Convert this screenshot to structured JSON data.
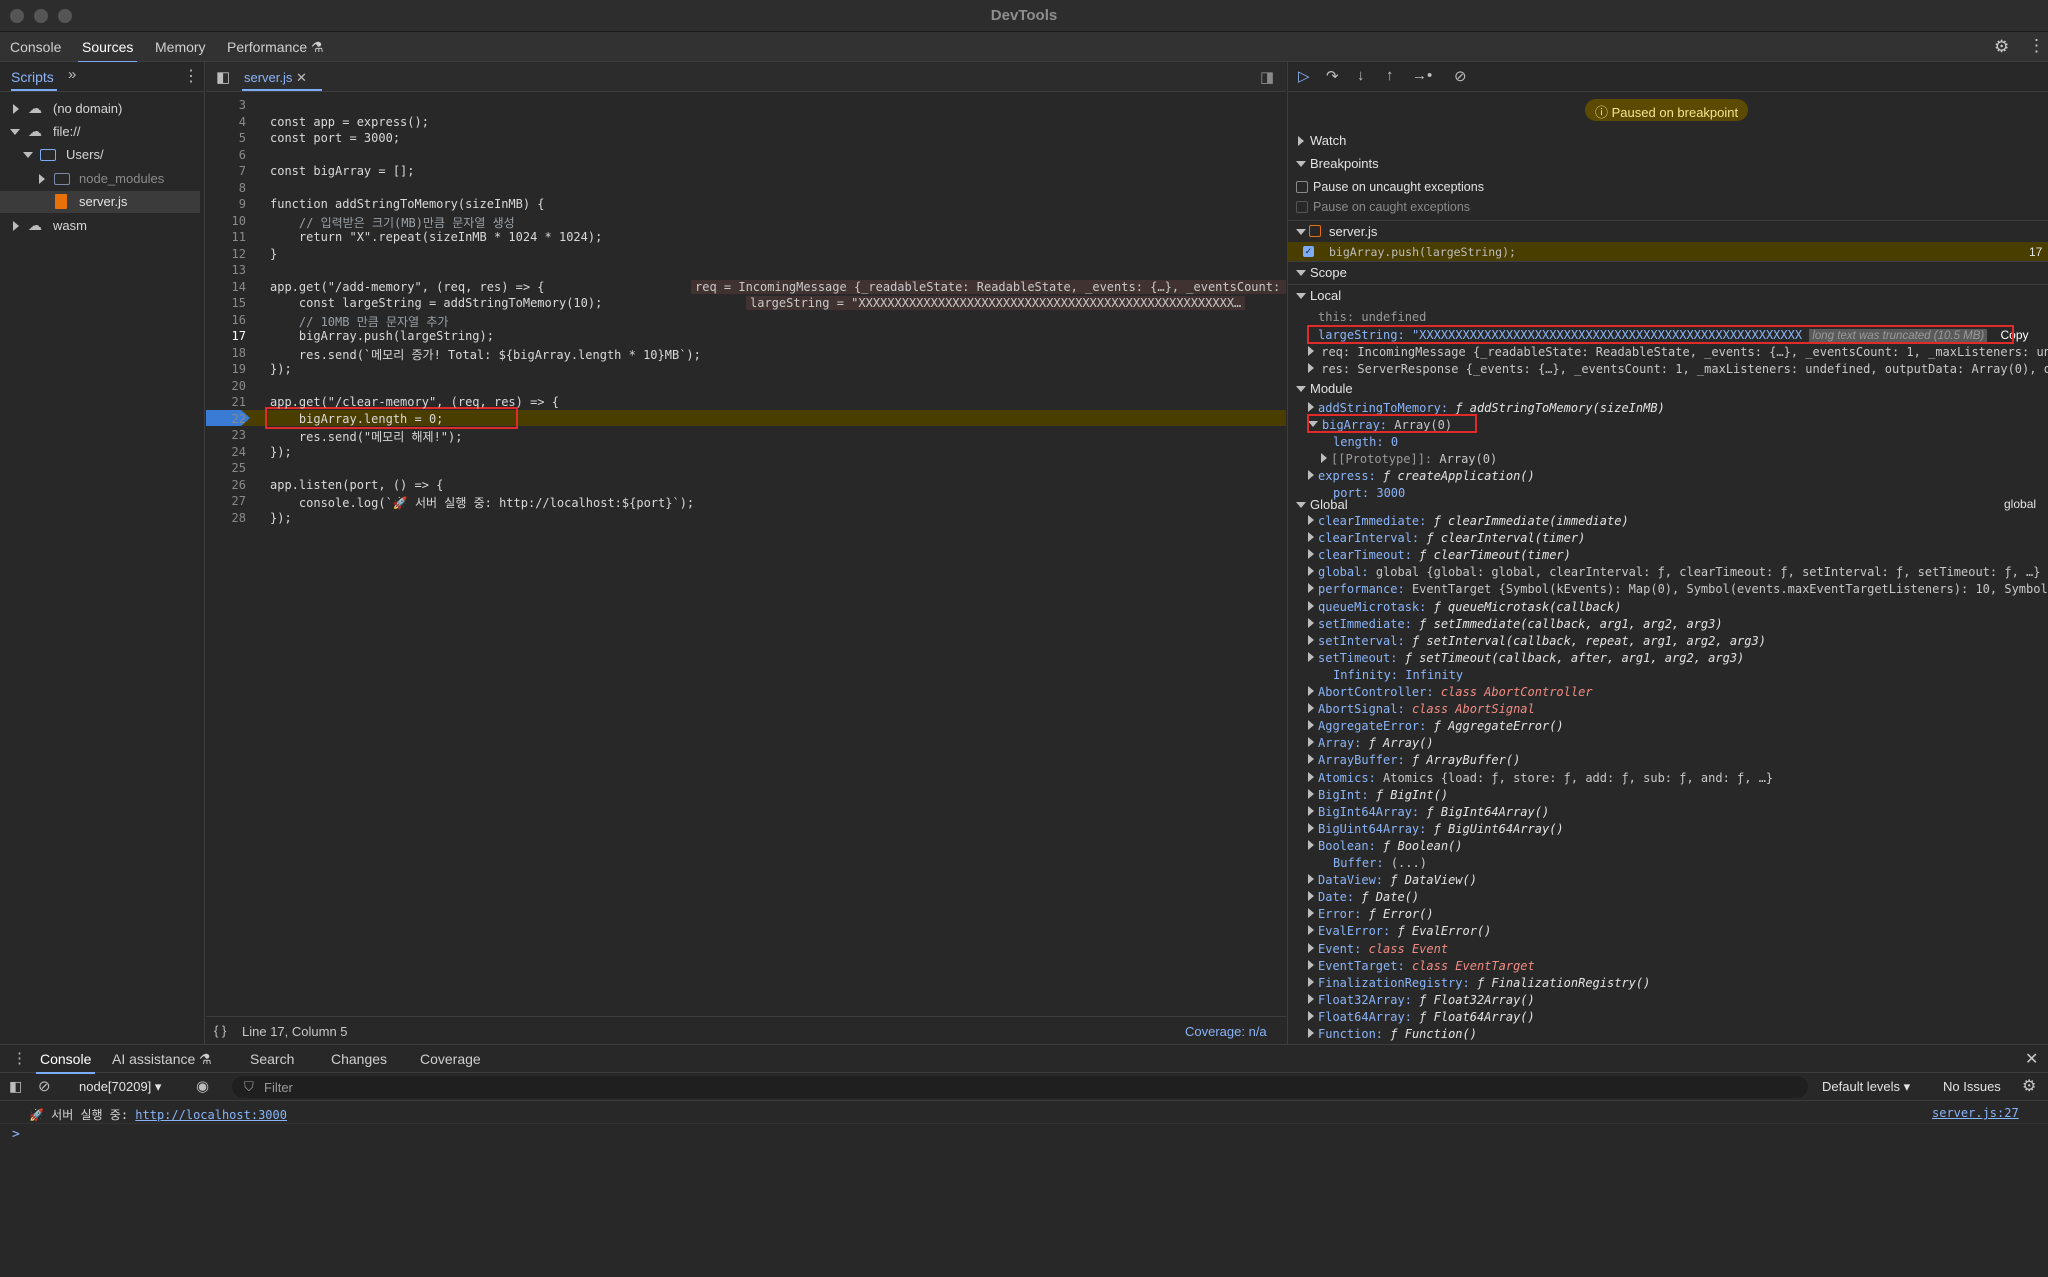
{
  "window": {
    "title": "DevTools"
  },
  "top_tabs": [
    "Console",
    "Sources",
    "Memory",
    "Performance"
  ],
  "navigator": {
    "tabs": [
      "Scripts"
    ],
    "tree": [
      {
        "label": "(no domain)"
      },
      {
        "label": "file://"
      },
      {
        "label": "Users/"
      },
      {
        "label": "node_modules"
      },
      {
        "label": "server.js"
      },
      {
        "label": "wasm"
      }
    ]
  },
  "editor": {
    "file_tab": "server.js",
    "status": "Line 17, Column 5",
    "coverage": "Coverage: n/a",
    "lines": [
      {
        "n": "3",
        "text": ""
      },
      {
        "n": "4",
        "text": "const app = express();"
      },
      {
        "n": "5",
        "text": "const port = 3000;"
      },
      {
        "n": "6",
        "text": ""
      },
      {
        "n": "7",
        "text": "const bigArray = [];"
      },
      {
        "n": "8",
        "text": ""
      },
      {
        "n": "9",
        "text": "function addStringToMemory(sizeInMB) {"
      },
      {
        "n": "10",
        "text": "    // 입력받은 크기(MB)만큼 문자열 생성"
      },
      {
        "n": "11",
        "text": "    return \"X\".repeat(sizeInMB * 1024 * 1024);"
      },
      {
        "n": "12",
        "text": "}"
      },
      {
        "n": "13",
        "text": ""
      },
      {
        "n": "14",
        "text": "app.get(\"/add-memory\", (req, res) => {"
      },
      {
        "n": "15",
        "text": "    const largeString = addStringToMemory(10);"
      },
      {
        "n": "16",
        "text": "    // 10MB 만큼 문자열 추가"
      },
      {
        "n": "17",
        "text": "    bigArray.push(largeString);"
      },
      {
        "n": "18",
        "text": "    res.send(`메모리 증가! Total: ${bigArray.length * 10}MB`);"
      },
      {
        "n": "19",
        "text": "});"
      },
      {
        "n": "20",
        "text": ""
      },
      {
        "n": "21",
        "text": "app.get(\"/clear-memory\", (req, res) => {"
      },
      {
        "n": "22",
        "text": "    bigArray.length = 0;"
      },
      {
        "n": "23",
        "text": "    res.send(\"메모리 해제!\");"
      },
      {
        "n": "24",
        "text": "});"
      },
      {
        "n": "25",
        "text": ""
      },
      {
        "n": "26",
        "text": "app.listen(port, () => {"
      },
      {
        "n": "27",
        "text": "    console.log(`🚀 서버 실행 중: http://localhost:${port}`);"
      },
      {
        "n": "28",
        "text": "});"
      }
    ],
    "inline_values": {
      "line14": "req = IncomingMessage {_readableState: ReadableState, _events: {…}, _eventsCount: 1, _maxListeners: unde",
      "line15": "largeString = \"XXXXXXXXXXXXXXXXXXXXXXXXXXXXXXXXXXXXXXXXXXXXXXXXXXXX…"
    }
  },
  "debugger": {
    "paused_banner": "Paused on breakpoint",
    "watch": "Watch",
    "breakpoints": "Breakpoints",
    "pause_uncaught": "Pause on uncaught exceptions",
    "pause_caught": "Pause on caught exceptions",
    "bp_file": "server.js",
    "bp_code": "bigArray.push(largeString);",
    "bp_line": "17",
    "scope": "Scope",
    "local": "Local",
    "this_row": "this: undefined",
    "largeString_key": "largeString:",
    "largeString_val": "\"XXXXXXXXXXXXXXXXXXXXXXXXXXXXXXXXXXXXXXXXXXXXXXXXXXXXX",
    "truncated": "long text was truncated (10.5 MB)",
    "copy": "Copy",
    "req_row": "req: IncomingMessage {_readableState: ReadableState, _events: {…}, _eventsCount: 1, _maxListeners: unde",
    "res_row": "res: ServerResponse {_events: {…}, _eventsCount: 1, _maxListeners: undefined, outputData: Array(0), outp",
    "module": "Module",
    "module_rows": [
      {
        "k": "addStringToMemory:",
        "v": "ƒ addStringToMemory(sizeInMB)"
      },
      {
        "k": "bigArray:",
        "v": "Array(0)"
      },
      {
        "k": "length:",
        "v": "0"
      },
      {
        "k": "[[Prototype]]:",
        "v": "Array(0)"
      },
      {
        "k": "express:",
        "v": "ƒ createApplication()"
      },
      {
        "k": "port:",
        "v": "3000"
      }
    ],
    "global": "Global",
    "global_tag": "global",
    "global_rows": [
      {
        "k": "clearImmediate:",
        "v": "ƒ clearImmediate(immediate)"
      },
      {
        "k": "clearInterval:",
        "v": "ƒ clearInterval(timer)"
      },
      {
        "k": "clearTimeout:",
        "v": "ƒ clearTimeout(timer)"
      },
      {
        "k": "global:",
        "v": "global {global: global, clearInterval: ƒ, clearTimeout: ƒ, setInterval: ƒ, setTimeout: ƒ, …}"
      },
      {
        "k": "performance:",
        "v": "EventTarget {Symbol(kEvents): Map(0), Symbol(events.maxEventTargetListeners): 10, Symbol(ev"
      },
      {
        "k": "queueMicrotask:",
        "v": "ƒ queueMicrotask(callback)"
      },
      {
        "k": "setImmediate:",
        "v": "ƒ setImmediate(callback, arg1, arg2, arg3)"
      },
      {
        "k": "setInterval:",
        "v": "ƒ setInterval(callback, repeat, arg1, arg2, arg3)"
      },
      {
        "k": "setTimeout:",
        "v": "ƒ setTimeout(callback, after, arg1, arg2, arg3)"
      },
      {
        "k": "Infinity:",
        "v": "Infinity"
      },
      {
        "k": "AbortController:",
        "v": "class AbortController"
      },
      {
        "k": "AbortSignal:",
        "v": "class AbortSignal"
      },
      {
        "k": "AggregateError:",
        "v": "ƒ AggregateError()"
      },
      {
        "k": "Array:",
        "v": "ƒ Array()"
      },
      {
        "k": "ArrayBuffer:",
        "v": "ƒ ArrayBuffer()"
      },
      {
        "k": "Atomics:",
        "v": "Atomics {load: ƒ, store: ƒ, add: ƒ, sub: ƒ, and: ƒ, …}"
      },
      {
        "k": "BigInt:",
        "v": "ƒ BigInt()"
      },
      {
        "k": "BigInt64Array:",
        "v": "ƒ BigInt64Array()"
      },
      {
        "k": "BigUint64Array:",
        "v": "ƒ BigUint64Array()"
      },
      {
        "k": "Boolean:",
        "v": "ƒ Boolean()"
      },
      {
        "k": "Buffer:",
        "v": "(...)"
      },
      {
        "k": "DataView:",
        "v": "ƒ DataView()"
      },
      {
        "k": "Date:",
        "v": "ƒ Date()"
      },
      {
        "k": "Error:",
        "v": "ƒ Error()"
      },
      {
        "k": "EvalError:",
        "v": "ƒ EvalError()"
      },
      {
        "k": "Event:",
        "v": "class Event"
      },
      {
        "k": "EventTarget:",
        "v": "class EventTarget"
      },
      {
        "k": "FinalizationRegistry:",
        "v": "ƒ FinalizationRegistry()"
      },
      {
        "k": "Float32Array:",
        "v": "ƒ Float32Array()"
      },
      {
        "k": "Float64Array:",
        "v": "ƒ Float64Array()"
      },
      {
        "k": "Function:",
        "v": "ƒ Function()"
      }
    ]
  },
  "console": {
    "tabs": [
      "Console",
      "AI assistance",
      "Search",
      "Changes",
      "Coverage"
    ],
    "context": "node[70209]",
    "filter_placeholder": "Filter",
    "levels": "Default levels",
    "issues": "No Issues",
    "message": "🚀 서버 실행 중: ",
    "message_link": "http://localhost:3000",
    "source": "server.js:27",
    "prompt": ">"
  },
  "colors": {
    "accent": "#7cacf8",
    "breakpoint": "#3a7bd5",
    "paused_banner": "#5c4a00",
    "highlight": "#e12b2b"
  }
}
